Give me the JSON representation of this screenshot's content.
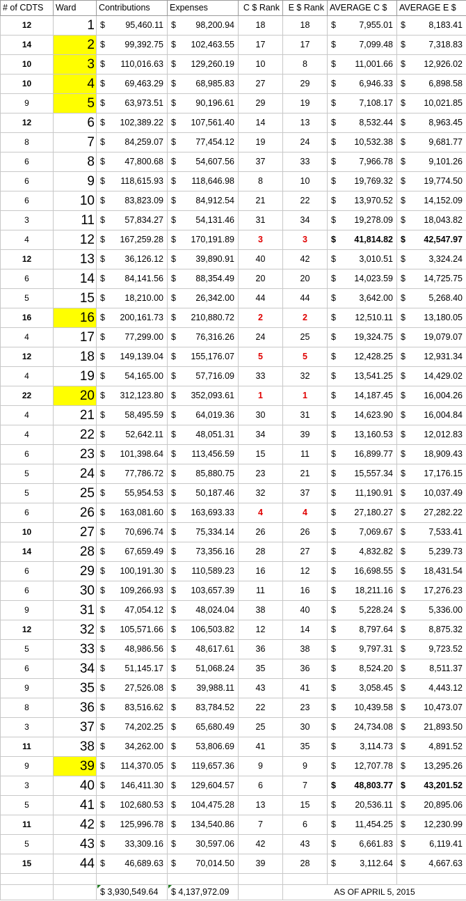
{
  "headers": {
    "cdts": "# of CDTS",
    "ward": "Ward",
    "contributions": "Contributions",
    "expenses": "Expenses",
    "c_rank": "C $ Rank",
    "e_rank": "E $ Rank",
    "avg_c": "AVERAGE C $",
    "avg_e": "AVERAGE E $"
  },
  "currency_symbol": "$",
  "highlight_color": "#ffff00",
  "top_rank_color": "#e00000",
  "rows": [
    {
      "cdts": "12",
      "ward": "1",
      "contrib": "95,460.11",
      "expense": "98,200.94",
      "c_rank": "18",
      "e_rank": "18",
      "avg_c": "7,955.01",
      "avg_e": "8,183.41",
      "highlight": false,
      "top": false,
      "bold_cdts": true,
      "bold_avg": false
    },
    {
      "cdts": "14",
      "ward": "2",
      "contrib": "99,392.75",
      "expense": "102,463.55",
      "c_rank": "17",
      "e_rank": "17",
      "avg_c": "7,099.48",
      "avg_e": "7,318.83",
      "highlight": true,
      "top": false,
      "bold_cdts": true,
      "bold_avg": false
    },
    {
      "cdts": "10",
      "ward": "3",
      "contrib": "110,016.63",
      "expense": "129,260.19",
      "c_rank": "10",
      "e_rank": "8",
      "avg_c": "11,001.66",
      "avg_e": "12,926.02",
      "highlight": true,
      "top": false,
      "bold_cdts": true,
      "bold_avg": false
    },
    {
      "cdts": "10",
      "ward": "4",
      "contrib": "69,463.29",
      "expense": "68,985.83",
      "c_rank": "27",
      "e_rank": "29",
      "avg_c": "6,946.33",
      "avg_e": "6,898.58",
      "highlight": true,
      "top": false,
      "bold_cdts": true,
      "bold_avg": false
    },
    {
      "cdts": "9",
      "ward": "5",
      "contrib": "63,973.51",
      "expense": "90,196.61",
      "c_rank": "29",
      "e_rank": "19",
      "avg_c": "7,108.17",
      "avg_e": "10,021.85",
      "highlight": true,
      "top": false,
      "bold_cdts": false,
      "bold_avg": false
    },
    {
      "cdts": "12",
      "ward": "6",
      "contrib": "102,389.22",
      "expense": "107,561.40",
      "c_rank": "14",
      "e_rank": "13",
      "avg_c": "8,532.44",
      "avg_e": "8,963.45",
      "highlight": false,
      "top": false,
      "bold_cdts": true,
      "bold_avg": false
    },
    {
      "cdts": "8",
      "ward": "7",
      "contrib": "84,259.07",
      "expense": "77,454.12",
      "c_rank": "19",
      "e_rank": "24",
      "avg_c": "10,532.38",
      "avg_e": "9,681.77",
      "highlight": false,
      "top": false,
      "bold_cdts": false,
      "bold_avg": false
    },
    {
      "cdts": "6",
      "ward": "8",
      "contrib": "47,800.68",
      "expense": "54,607.56",
      "c_rank": "37",
      "e_rank": "33",
      "avg_c": "7,966.78",
      "avg_e": "9,101.26",
      "highlight": false,
      "top": false,
      "bold_cdts": false,
      "bold_avg": false
    },
    {
      "cdts": "6",
      "ward": "9",
      "contrib": "118,615.93",
      "expense": "118,646.98",
      "c_rank": "8",
      "e_rank": "10",
      "avg_c": "19,769.32",
      "avg_e": "19,774.50",
      "highlight": false,
      "top": false,
      "bold_cdts": false,
      "bold_avg": false
    },
    {
      "cdts": "6",
      "ward": "10",
      "contrib": "83,823.09",
      "expense": "84,912.54",
      "c_rank": "21",
      "e_rank": "22",
      "avg_c": "13,970.52",
      "avg_e": "14,152.09",
      "highlight": false,
      "top": false,
      "bold_cdts": false,
      "bold_avg": false
    },
    {
      "cdts": "3",
      "ward": "11",
      "contrib": "57,834.27",
      "expense": "54,131.46",
      "c_rank": "31",
      "e_rank": "34",
      "avg_c": "19,278.09",
      "avg_e": "18,043.82",
      "highlight": false,
      "top": false,
      "bold_cdts": false,
      "bold_avg": false
    },
    {
      "cdts": "4",
      "ward": "12",
      "contrib": "167,259.28",
      "expense": "170,191.89",
      "c_rank": "3",
      "e_rank": "3",
      "avg_c": "41,814.82",
      "avg_e": "42,547.97",
      "highlight": false,
      "top": true,
      "bold_cdts": false,
      "bold_avg": true
    },
    {
      "cdts": "12",
      "ward": "13",
      "contrib": "36,126.12",
      "expense": "39,890.91",
      "c_rank": "40",
      "e_rank": "42",
      "avg_c": "3,010.51",
      "avg_e": "3,324.24",
      "highlight": false,
      "top": false,
      "bold_cdts": true,
      "bold_avg": false
    },
    {
      "cdts": "6",
      "ward": "14",
      "contrib": "84,141.56",
      "expense": "88,354.49",
      "c_rank": "20",
      "e_rank": "20",
      "avg_c": "14,023.59",
      "avg_e": "14,725.75",
      "highlight": false,
      "top": false,
      "bold_cdts": false,
      "bold_avg": false
    },
    {
      "cdts": "5",
      "ward": "15",
      "contrib": "18,210.00",
      "expense": "26,342.00",
      "c_rank": "44",
      "e_rank": "44",
      "avg_c": "3,642.00",
      "avg_e": "5,268.40",
      "highlight": false,
      "top": false,
      "bold_cdts": false,
      "bold_avg": false
    },
    {
      "cdts": "16",
      "ward": "16",
      "contrib": "200,161.73",
      "expense": "210,880.72",
      "c_rank": "2",
      "e_rank": "2",
      "avg_c": "12,510.11",
      "avg_e": "13,180.05",
      "highlight": true,
      "top": true,
      "bold_cdts": true,
      "bold_avg": false
    },
    {
      "cdts": "4",
      "ward": "17",
      "contrib": "77,299.00",
      "expense": "76,316.26",
      "c_rank": "24",
      "e_rank": "25",
      "avg_c": "19,324.75",
      "avg_e": "19,079.07",
      "highlight": false,
      "top": false,
      "bold_cdts": false,
      "bold_avg": false
    },
    {
      "cdts": "12",
      "ward": "18",
      "contrib": "149,139.04",
      "expense": "155,176.07",
      "c_rank": "5",
      "e_rank": "5",
      "avg_c": "12,428.25",
      "avg_e": "12,931.34",
      "highlight": false,
      "top": true,
      "bold_cdts": true,
      "bold_avg": false
    },
    {
      "cdts": "4",
      "ward": "19",
      "contrib": "54,165.00",
      "expense": "57,716.09",
      "c_rank": "33",
      "e_rank": "32",
      "avg_c": "13,541.25",
      "avg_e": "14,429.02",
      "highlight": false,
      "top": false,
      "bold_cdts": false,
      "bold_avg": false
    },
    {
      "cdts": "22",
      "ward": "20",
      "contrib": "312,123.80",
      "expense": "352,093.61",
      "c_rank": "1",
      "e_rank": "1",
      "avg_c": "14,187.45",
      "avg_e": "16,004.26",
      "highlight": true,
      "top": true,
      "bold_cdts": true,
      "bold_avg": false
    },
    {
      "cdts": "4",
      "ward": "21",
      "contrib": "58,495.59",
      "expense": "64,019.36",
      "c_rank": "30",
      "e_rank": "31",
      "avg_c": "14,623.90",
      "avg_e": "16,004.84",
      "highlight": false,
      "top": false,
      "bold_cdts": false,
      "bold_avg": false
    },
    {
      "cdts": "4",
      "ward": "22",
      "contrib": "52,642.11",
      "expense": "48,051.31",
      "c_rank": "34",
      "e_rank": "39",
      "avg_c": "13,160.53",
      "avg_e": "12,012.83",
      "highlight": false,
      "top": false,
      "bold_cdts": false,
      "bold_avg": false
    },
    {
      "cdts": "6",
      "ward": "23",
      "contrib": "101,398.64",
      "expense": "113,456.59",
      "c_rank": "15",
      "e_rank": "11",
      "avg_c": "16,899.77",
      "avg_e": "18,909.43",
      "highlight": false,
      "top": false,
      "bold_cdts": false,
      "bold_avg": false
    },
    {
      "cdts": "5",
      "ward": "24",
      "contrib": "77,786.72",
      "expense": "85,880.75",
      "c_rank": "23",
      "e_rank": "21",
      "avg_c": "15,557.34",
      "avg_e": "17,176.15",
      "highlight": false,
      "top": false,
      "bold_cdts": false,
      "bold_avg": false
    },
    {
      "cdts": "5",
      "ward": "25",
      "contrib": "55,954.53",
      "expense": "50,187.46",
      "c_rank": "32",
      "e_rank": "37",
      "avg_c": "11,190.91",
      "avg_e": "10,037.49",
      "highlight": false,
      "top": false,
      "bold_cdts": false,
      "bold_avg": false
    },
    {
      "cdts": "6",
      "ward": "26",
      "contrib": "163,081.60",
      "expense": "163,693.33",
      "c_rank": "4",
      "e_rank": "4",
      "avg_c": "27,180.27",
      "avg_e": "27,282.22",
      "highlight": false,
      "top": true,
      "bold_cdts": false,
      "bold_avg": false
    },
    {
      "cdts": "10",
      "ward": "27",
      "contrib": "70,696.74",
      "expense": "75,334.14",
      "c_rank": "26",
      "e_rank": "26",
      "avg_c": "7,069.67",
      "avg_e": "7,533.41",
      "highlight": false,
      "top": false,
      "bold_cdts": true,
      "bold_avg": false
    },
    {
      "cdts": "14",
      "ward": "28",
      "contrib": "67,659.49",
      "expense": "73,356.16",
      "c_rank": "28",
      "e_rank": "27",
      "avg_c": "4,832.82",
      "avg_e": "5,239.73",
      "highlight": false,
      "top": false,
      "bold_cdts": true,
      "bold_avg": false
    },
    {
      "cdts": "6",
      "ward": "29",
      "contrib": "100,191.30",
      "expense": "110,589.23",
      "c_rank": "16",
      "e_rank": "12",
      "avg_c": "16,698.55",
      "avg_e": "18,431.54",
      "highlight": false,
      "top": false,
      "bold_cdts": false,
      "bold_avg": false
    },
    {
      "cdts": "6",
      "ward": "30",
      "contrib": "109,266.93",
      "expense": "103,657.39",
      "c_rank": "11",
      "e_rank": "16",
      "avg_c": "18,211.16",
      "avg_e": "17,276.23",
      "highlight": false,
      "top": false,
      "bold_cdts": false,
      "bold_avg": false
    },
    {
      "cdts": "9",
      "ward": "31",
      "contrib": "47,054.12",
      "expense": "48,024.04",
      "c_rank": "38",
      "e_rank": "40",
      "avg_c": "5,228.24",
      "avg_e": "5,336.00",
      "highlight": false,
      "top": false,
      "bold_cdts": false,
      "bold_avg": false
    },
    {
      "cdts": "12",
      "ward": "32",
      "contrib": "105,571.66",
      "expense": "106,503.82",
      "c_rank": "12",
      "e_rank": "14",
      "avg_c": "8,797.64",
      "avg_e": "8,875.32",
      "highlight": false,
      "top": false,
      "bold_cdts": true,
      "bold_avg": false
    },
    {
      "cdts": "5",
      "ward": "33",
      "contrib": "48,986.56",
      "expense": "48,617.61",
      "c_rank": "36",
      "e_rank": "38",
      "avg_c": "9,797.31",
      "avg_e": "9,723.52",
      "highlight": false,
      "top": false,
      "bold_cdts": false,
      "bold_avg": false
    },
    {
      "cdts": "6",
      "ward": "34",
      "contrib": "51,145.17",
      "expense": "51,068.24",
      "c_rank": "35",
      "e_rank": "36",
      "avg_c": "8,524.20",
      "avg_e": "8,511.37",
      "highlight": false,
      "top": false,
      "bold_cdts": false,
      "bold_avg": false
    },
    {
      "cdts": "9",
      "ward": "35",
      "contrib": "27,526.08",
      "expense": "39,988.11",
      "c_rank": "43",
      "e_rank": "41",
      "avg_c": "3,058.45",
      "avg_e": "4,443.12",
      "highlight": false,
      "top": false,
      "bold_cdts": false,
      "bold_avg": false
    },
    {
      "cdts": "8",
      "ward": "36",
      "contrib": "83,516.62",
      "expense": "83,784.52",
      "c_rank": "22",
      "e_rank": "23",
      "avg_c": "10,439.58",
      "avg_e": "10,473.07",
      "highlight": false,
      "top": false,
      "bold_cdts": false,
      "bold_avg": false
    },
    {
      "cdts": "3",
      "ward": "37",
      "contrib": "74,202.25",
      "expense": "65,680.49",
      "c_rank": "25",
      "e_rank": "30",
      "avg_c": "24,734.08",
      "avg_e": "21,893.50",
      "highlight": false,
      "top": false,
      "bold_cdts": false,
      "bold_avg": false
    },
    {
      "cdts": "11",
      "ward": "38",
      "contrib": "34,262.00",
      "expense": "53,806.69",
      "c_rank": "41",
      "e_rank": "35",
      "avg_c": "3,114.73",
      "avg_e": "4,891.52",
      "highlight": false,
      "top": false,
      "bold_cdts": true,
      "bold_avg": false
    },
    {
      "cdts": "9",
      "ward": "39",
      "contrib": "114,370.05",
      "expense": "119,657.36",
      "c_rank": "9",
      "e_rank": "9",
      "avg_c": "12,707.78",
      "avg_e": "13,295.26",
      "highlight": true,
      "top": false,
      "bold_cdts": false,
      "bold_avg": false
    },
    {
      "cdts": "3",
      "ward": "40",
      "contrib": "146,411.30",
      "expense": "129,604.57",
      "c_rank": "6",
      "e_rank": "7",
      "avg_c": "48,803.77",
      "avg_e": "43,201.52",
      "highlight": false,
      "top": false,
      "bold_cdts": false,
      "bold_avg": true
    },
    {
      "cdts": "5",
      "ward": "41",
      "contrib": "102,680.53",
      "expense": "104,475.28",
      "c_rank": "13",
      "e_rank": "15",
      "avg_c": "20,536.11",
      "avg_e": "20,895.06",
      "highlight": false,
      "top": false,
      "bold_cdts": false,
      "bold_avg": false
    },
    {
      "cdts": "11",
      "ward": "42",
      "contrib": "125,996.78",
      "expense": "134,540.86",
      "c_rank": "7",
      "e_rank": "6",
      "avg_c": "11,454.25",
      "avg_e": "12,230.99",
      "highlight": false,
      "top": false,
      "bold_cdts": true,
      "bold_avg": false
    },
    {
      "cdts": "5",
      "ward": "43",
      "contrib": "33,309.16",
      "expense": "30,597.06",
      "c_rank": "42",
      "e_rank": "43",
      "avg_c": "6,661.83",
      "avg_e": "6,119.41",
      "highlight": false,
      "top": false,
      "bold_cdts": false,
      "bold_avg": false
    },
    {
      "cdts": "15",
      "ward": "44",
      "contrib": "46,689.63",
      "expense": "70,014.50",
      "c_rank": "39",
      "e_rank": "28",
      "avg_c": "3,112.64",
      "avg_e": "4,667.63",
      "highlight": false,
      "top": false,
      "bold_cdts": true,
      "bold_avg": false
    }
  ],
  "totals": {
    "contributions": "$ 3,930,549.64",
    "expenses": "$ 4,137,972.09",
    "as_of": "AS OF APRIL 5, 2015"
  }
}
